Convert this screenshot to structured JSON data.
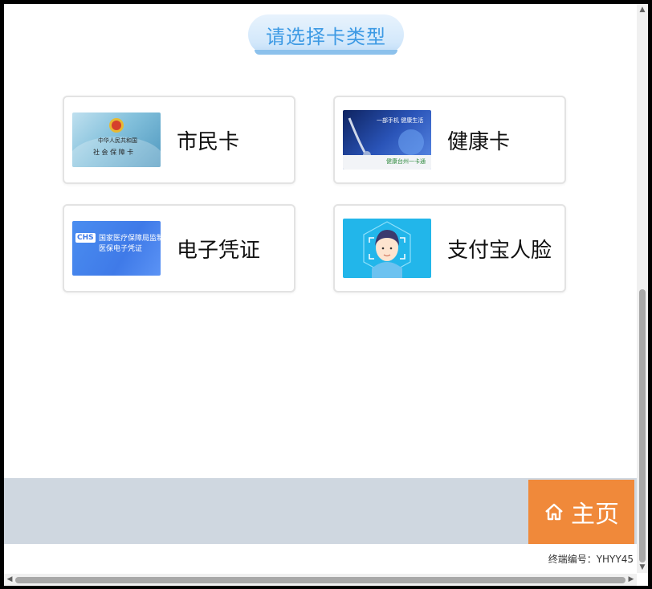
{
  "title": "请选择卡类型",
  "cards": [
    {
      "label": "市民卡",
      "thumb": {
        "line1": "中华人民共和国",
        "line2": "社 会 保 障 卡"
      }
    },
    {
      "label": "健康卡",
      "thumb": {
        "line1": "一部手机 健康生活",
        "line2": "健康台州一卡通"
      }
    },
    {
      "label": "电子凭证",
      "thumb": {
        "logo": "CHS",
        "line1": "国家医疗保障局监制",
        "line2": "医保电子凭证"
      }
    },
    {
      "label": "支付宝人脸",
      "thumb": {}
    }
  ],
  "footer": {
    "home_label": "主页",
    "terminal_id": "终端编号：YHYY45"
  },
  "colors": {
    "title_text": "#3d9ae4",
    "home_button": "#f0893a",
    "footer_bar": "#cfd7e0"
  },
  "icons": {
    "home": "home-icon",
    "emblem": "national-emblem-icon",
    "face": "face-scan-icon"
  }
}
